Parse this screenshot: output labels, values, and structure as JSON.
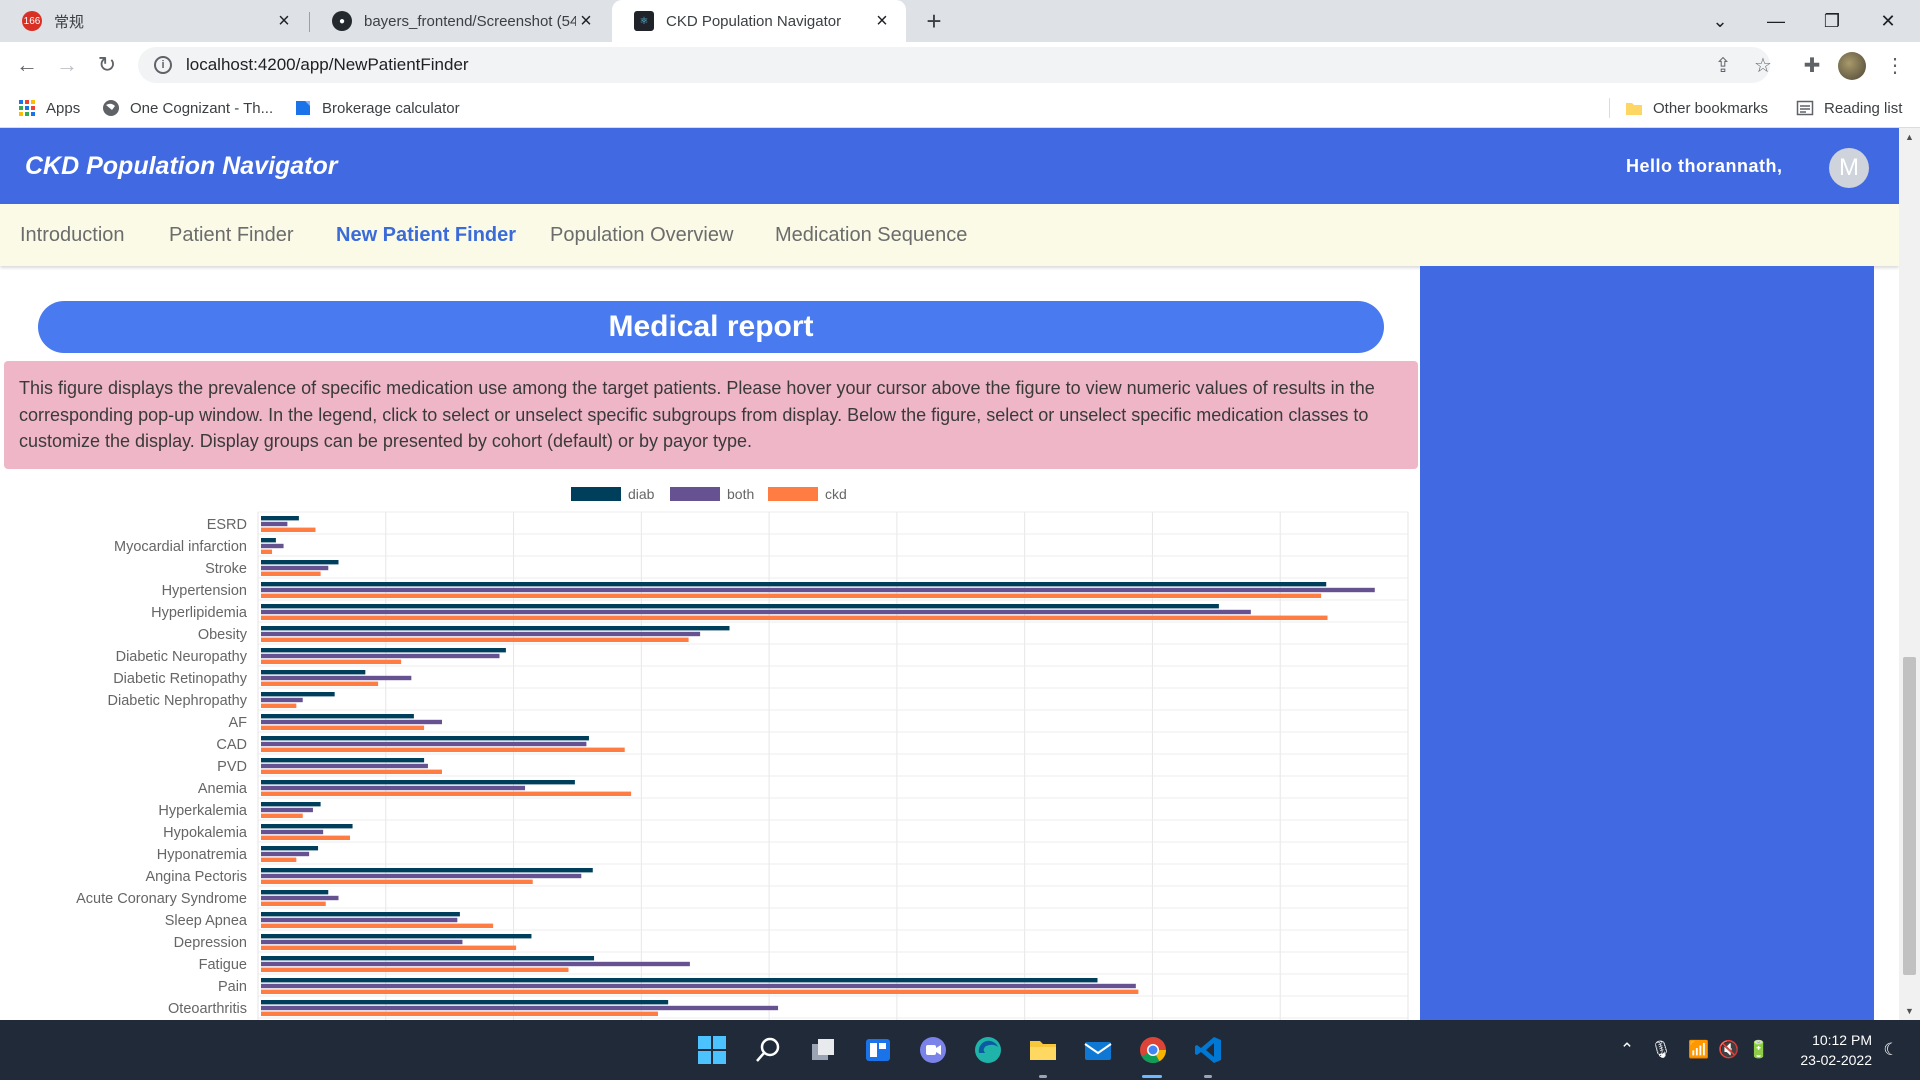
{
  "browser": {
    "tabs": [
      {
        "title": "常规",
        "badge": "166"
      },
      {
        "title": "bayers_frontend/Screenshot (54)"
      },
      {
        "title": "CKD Population Navigator"
      }
    ],
    "url": "localhost:4200/app/NewPatientFinder",
    "bookmarks": [
      "Apps",
      "One Cognizant - Th...",
      "Brokerage calculator"
    ],
    "other_bookmarks": "Other bookmarks",
    "reading_list": "Reading list"
  },
  "app": {
    "title": "CKD Population Navigator",
    "greeting": "Hello thorannath,",
    "avatar_letter": "M",
    "nav": [
      "Introduction",
      "Patient Finder",
      "New Patient Finder",
      "Population Overview",
      "Medication Sequence"
    ],
    "active_nav": "New Patient Finder",
    "panel_color": "#4169e1"
  },
  "report": {
    "title": "Medical report",
    "description": "This figure displays the prevalence of specific medication use among the target patients. Please hover your cursor above the figure to view numeric values of results in the corresponding pop-up window. In the legend, click to select or unselect specific subgroups from display. Below the figure, select or unselect specific medication classes to customize the display. Display groups can be presented by cohort (default) or by payor type."
  },
  "chart_data": {
    "type": "bar",
    "orientation": "horizontal",
    "grid": true,
    "legend_position": "top-center",
    "xlim": [
      0,
      90
    ],
    "categories": [
      "ESRD",
      "Myocardial infarction",
      "Stroke",
      "Hypertension",
      "Hyperlipidemia",
      "Obesity",
      "Diabetic Neuropathy",
      "Diabetic Retinopathy",
      "Diabetic Nephropathy",
      "AF",
      "CAD",
      "PVD",
      "Anemia",
      "Hyperkalemia",
      "Hypokalemia",
      "Hyponatremia",
      "Angina Pectoris",
      "Acute Coronary Syndrome",
      "Sleep Apnea",
      "Depression",
      "Fatigue",
      "Pain",
      "Oteoarthritis"
    ],
    "series": [
      {
        "name": "diab",
        "color": "#003f5c",
        "values": [
          3.2,
          1.4,
          6.3,
          83.6,
          75.2,
          36.9,
          19.4,
          8.4,
          6.0,
          12.2,
          25.9,
          13.0,
          24.8,
          4.9,
          7.4,
          4.7,
          26.2,
          5.5,
          15.8,
          21.4,
          26.3,
          65.7,
          32.1
        ]
      },
      {
        "name": "both",
        "color": "#665191",
        "values": [
          2.3,
          2.0,
          5.5,
          87.4,
          77.7,
          34.6,
          18.9,
          12.0,
          3.5,
          14.4,
          25.7,
          13.3,
          20.9,
          4.3,
          5.1,
          4.0,
          25.3,
          6.3,
          15.6,
          16.0,
          33.8,
          68.7,
          40.7
        ]
      },
      {
        "name": "ckd",
        "color": "#ff7c43",
        "values": [
          4.5,
          1.1,
          4.9,
          83.2,
          83.7,
          33.7,
          11.2,
          9.4,
          3.0,
          13.0,
          28.7,
          14.4,
          29.2,
          3.5,
          7.2,
          3.0,
          21.5,
          5.3,
          18.4,
          20.2,
          24.3,
          68.9,
          31.3
        ]
      }
    ]
  },
  "taskbar": {
    "time": "10:12 PM",
    "date": "23-02-2022"
  }
}
